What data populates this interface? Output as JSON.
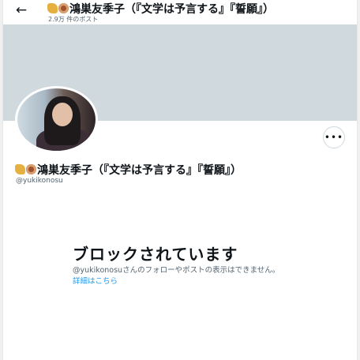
{
  "header": {
    "back_icon": "arrow-left-icon",
    "title": "鴻巣友季子（『文学は予言する』『誓願』）",
    "post_count": "2.9万 件のポスト"
  },
  "profile": {
    "name": "鴻巣友季子（『文学は予言する』『誓願』）",
    "handle": "@yukikonosu",
    "emoji_icons": [
      "dog-icon",
      "monkey-icon"
    ],
    "more_icon": "more-horizontal-icon",
    "more_label": "•••"
  },
  "blocked": {
    "title": "ブロックされています",
    "message": "@yukikonosuさんのフォローやポストの表示はできません。",
    "link": "詳細はこちら"
  },
  "colors": {
    "banner": "#cfd9de",
    "link": "#1d9bf0",
    "secondary_text": "#536471"
  }
}
